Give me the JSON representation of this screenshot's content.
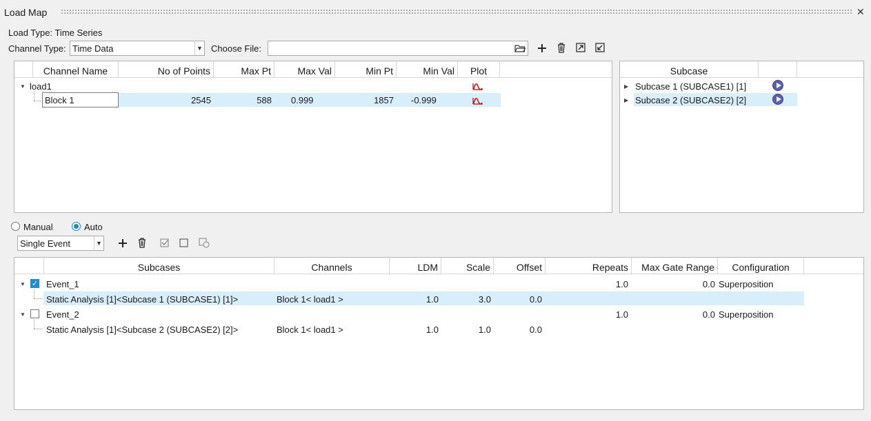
{
  "window": {
    "title": "Load Map",
    "close_glyph": "✕"
  },
  "load_type": "Load Type: Time Series",
  "channel_type": {
    "label": "Channel Type:",
    "value": "Time Data"
  },
  "choose_file": {
    "label": "Choose File:",
    "value": ""
  },
  "toolbar_icons": [
    "folder-open-icon",
    "add-icon",
    "delete-icon",
    "export-icon",
    "import-icon"
  ],
  "channels": {
    "headers": [
      "Channel Name",
      "No of Points",
      "Max Pt",
      "Max Val",
      "Min Pt",
      "Min Val",
      "Plot"
    ],
    "group": "load1",
    "rows": [
      {
        "name": "Block 1",
        "points": "2545",
        "max_pt": "588",
        "max_val": "0.999",
        "min_pt": "1857",
        "min_val": "-0.999"
      }
    ]
  },
  "subcase_panel": {
    "header": "Subcase",
    "items": [
      "Subcase 1 (SUBCASE1) [1]",
      "Subcase 2 (SUBCASE2) [2]"
    ]
  },
  "mode": {
    "manual": "Manual",
    "auto": "Auto",
    "selected": "Auto"
  },
  "event_type": {
    "value": "Single Event"
  },
  "events_table": {
    "headers": [
      "Subcases",
      "Channels",
      "LDM",
      "Scale",
      "Offset",
      "Repeats",
      "Max Gate Range",
      "Configuration"
    ],
    "events": [
      {
        "name": "Event_1",
        "checked": true,
        "repeats": "1.0",
        "max_gate_range": "0.0",
        "configuration": "Superposition",
        "child": {
          "subcase": "Static Analysis [1]<Subcase 1 (SUBCASE1) [1]>",
          "channel": "Block 1< load1 >",
          "ldm": "1.0",
          "scale": "3.0",
          "offset": "0.0"
        }
      },
      {
        "name": "Event_2",
        "checked": false,
        "repeats": "1.0",
        "max_gate_range": "0.0",
        "configuration": "Superposition",
        "child": {
          "subcase": "Static Analysis [1]<Subcase 2 (SUBCASE2) [2]>",
          "channel": "Block 1< load1 >",
          "ldm": "1.0",
          "scale": "1.0",
          "offset": "0.0"
        }
      }
    ]
  },
  "colors": {
    "selection": "#d9eefb",
    "accent": "#1689d6",
    "play": "#5a5fb0",
    "plot_icon": "#d0021b"
  }
}
